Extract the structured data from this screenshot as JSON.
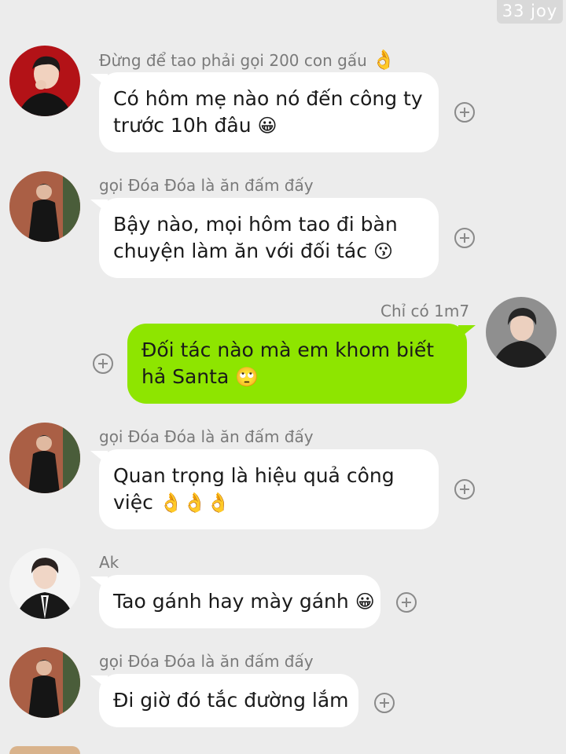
{
  "watermark": "33 joy",
  "messages": [
    {
      "sender": "Đừng để tao phải gọi 200 con gấu",
      "sender_emoji": "👌",
      "lines": [
        "Có hôm mẹ nào nó đến công ty",
        "trước 10h đâu"
      ],
      "emoji": "😀",
      "avatar": "avatar-red-suit",
      "mine": false
    },
    {
      "sender": "gọi Đóa Đóa là ăn đấm đấy",
      "lines": [
        "Bậy nào, mọi hôm tao đi bàn",
        "chuyện làm ăn với đối tác"
      ],
      "emoji": "😗",
      "avatar": "avatar-brick-wall",
      "mine": false
    },
    {
      "sender": "Chỉ có 1m7",
      "lines": [
        "Đối tác nào mà em khom biết",
        "hả Santa"
      ],
      "emoji": "🙄",
      "avatar": "avatar-dark-jacket",
      "mine": true
    },
    {
      "sender": "gọi Đóa Đóa là ăn đấm đấy",
      "lines": [
        "Quan trọng là hiệu quả công",
        "việc"
      ],
      "emoji": "👌👌👌",
      "avatar": "avatar-brick-wall",
      "mine": false
    },
    {
      "sender": "Ak",
      "lines": [
        "Tao gánh hay mày gánh"
      ],
      "emoji": "😀",
      "avatar": "avatar-suit-tie",
      "mine": false
    },
    {
      "sender": "gọi Đóa Đóa là ăn đấm đấy",
      "lines": [
        "Đi giờ đó tắc đường lắm"
      ],
      "emoji": "",
      "avatar": "avatar-brick-wall",
      "mine": false
    }
  ],
  "colors": {
    "background": "#ececec",
    "my_bubble": "#8ee500",
    "other_bubble": "#ffffff",
    "sender_text": "#7a7a7a"
  }
}
